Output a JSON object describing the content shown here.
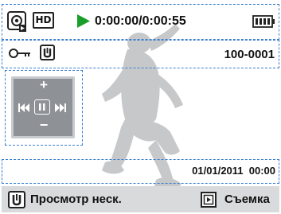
{
  "top_bar": {
    "mode_icon": "video-playback-mode-icon",
    "quality_icon": "hd-icon",
    "quality_label": "HD",
    "play_icon": "play-icon",
    "time": "0:00:00/0:00:55",
    "battery_icon": "battery-icon"
  },
  "second_bar": {
    "protect_icon": "key-protect-icon",
    "multi_view_icon": "multi-view-icon",
    "file_number": "100-0001"
  },
  "controls": {
    "volume_up": "+",
    "volume_down": "−",
    "rewind_icon": "rewind-icon",
    "pause_icon": "pause-icon",
    "forward_icon": "fast-forward-icon"
  },
  "date_time": "01/01/2011  00:00",
  "bottom_bar": {
    "multi_view_label": "Просмотр неск.",
    "capture_label": "Съемка",
    "multi_view_icon": "multi-view-icon",
    "capture_icon": "capture-icon"
  },
  "colors": {
    "accent": "#3a7fd0",
    "play": "#1a9e2a",
    "bar": "#d9dadb",
    "control": "#8e9297"
  }
}
